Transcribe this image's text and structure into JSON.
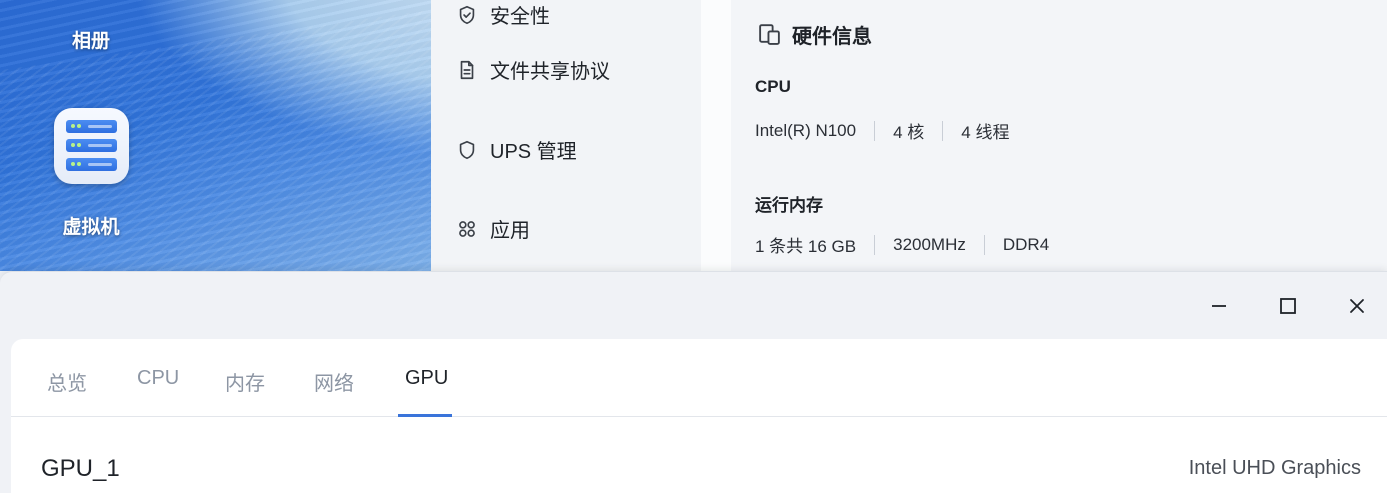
{
  "desktop": {
    "icons": [
      {
        "label": "相册"
      },
      {
        "label": "虚拟机",
        "icon": "server-stack-icon"
      }
    ]
  },
  "settings_menu": {
    "items": [
      {
        "label": "安全性",
        "icon": "shield-check-icon"
      },
      {
        "label": "文件共享协议",
        "icon": "document-icon"
      },
      {
        "label": "UPS 管理",
        "icon": "shield-icon"
      },
      {
        "label": "应用",
        "icon": "apps-grid-icon"
      }
    ]
  },
  "hardware_info": {
    "title": "硬件信息",
    "icon": "devices-icon",
    "cpu": {
      "label": "CPU",
      "model": "Intel(R) N100",
      "cores": "4 核",
      "threads": "4 线程"
    },
    "memory": {
      "label": "运行内存",
      "modules": "1 条共 16 GB",
      "speed": "3200MHz",
      "type": "DDR4"
    }
  },
  "window": {
    "controls": [
      "minimize-icon",
      "maximize-icon",
      "close-icon"
    ],
    "tabs": [
      {
        "label": "总览",
        "active": false
      },
      {
        "label": "CPU",
        "active": false
      },
      {
        "label": "内存",
        "active": false
      },
      {
        "label": "网络",
        "active": false
      },
      {
        "label": "GPU",
        "active": true
      }
    ],
    "gpu": {
      "name": "GPU_1",
      "model": "Intel UHD Graphics"
    }
  },
  "colors": {
    "accent": "#3a74da",
    "tab_inactive": "#8d96a4",
    "text": "#1f2329"
  }
}
